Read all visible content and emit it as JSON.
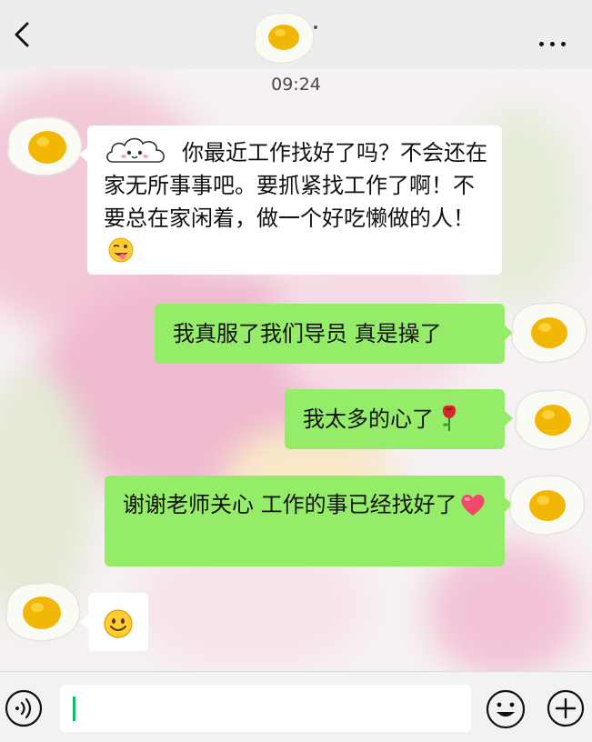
{
  "header": {
    "back_icon": "chevron-left-icon",
    "contact_avatar": "fried-egg-avatar",
    "more_icon": "more-dots-icon"
  },
  "chat": {
    "timestamp": "09:24",
    "messages": [
      {
        "side": "in",
        "emoji": "cloud-face",
        "text": "你最近工作找好了吗？不会还在家无所事事吧。要抓紧找工作了啊！不要总在家闲着，做一个好吃懒做的人！",
        "trailing_emoji": "winking-tongue-face"
      },
      {
        "side": "out",
        "text": "我真服了我们导员 真是操了"
      },
      {
        "side": "out",
        "text": "我太多的心了",
        "trailing_emoji": "rose"
      },
      {
        "side": "out",
        "text": "谢谢老师关心 工作的事已经找好了",
        "trailing_emoji": "pink-heart"
      },
      {
        "side": "in",
        "emoji": "smiling-face"
      }
    ]
  },
  "input_bar": {
    "voice_icon": "voice-icon",
    "input_value": "",
    "sticker_icon": "smiley-sticker-icon",
    "plus_icon": "plus-icon"
  },
  "colors": {
    "header_bg": "#ededed",
    "incoming_bubble": "#ffffff",
    "outgoing_bubble": "#95ec69",
    "caret": "#07c160"
  }
}
